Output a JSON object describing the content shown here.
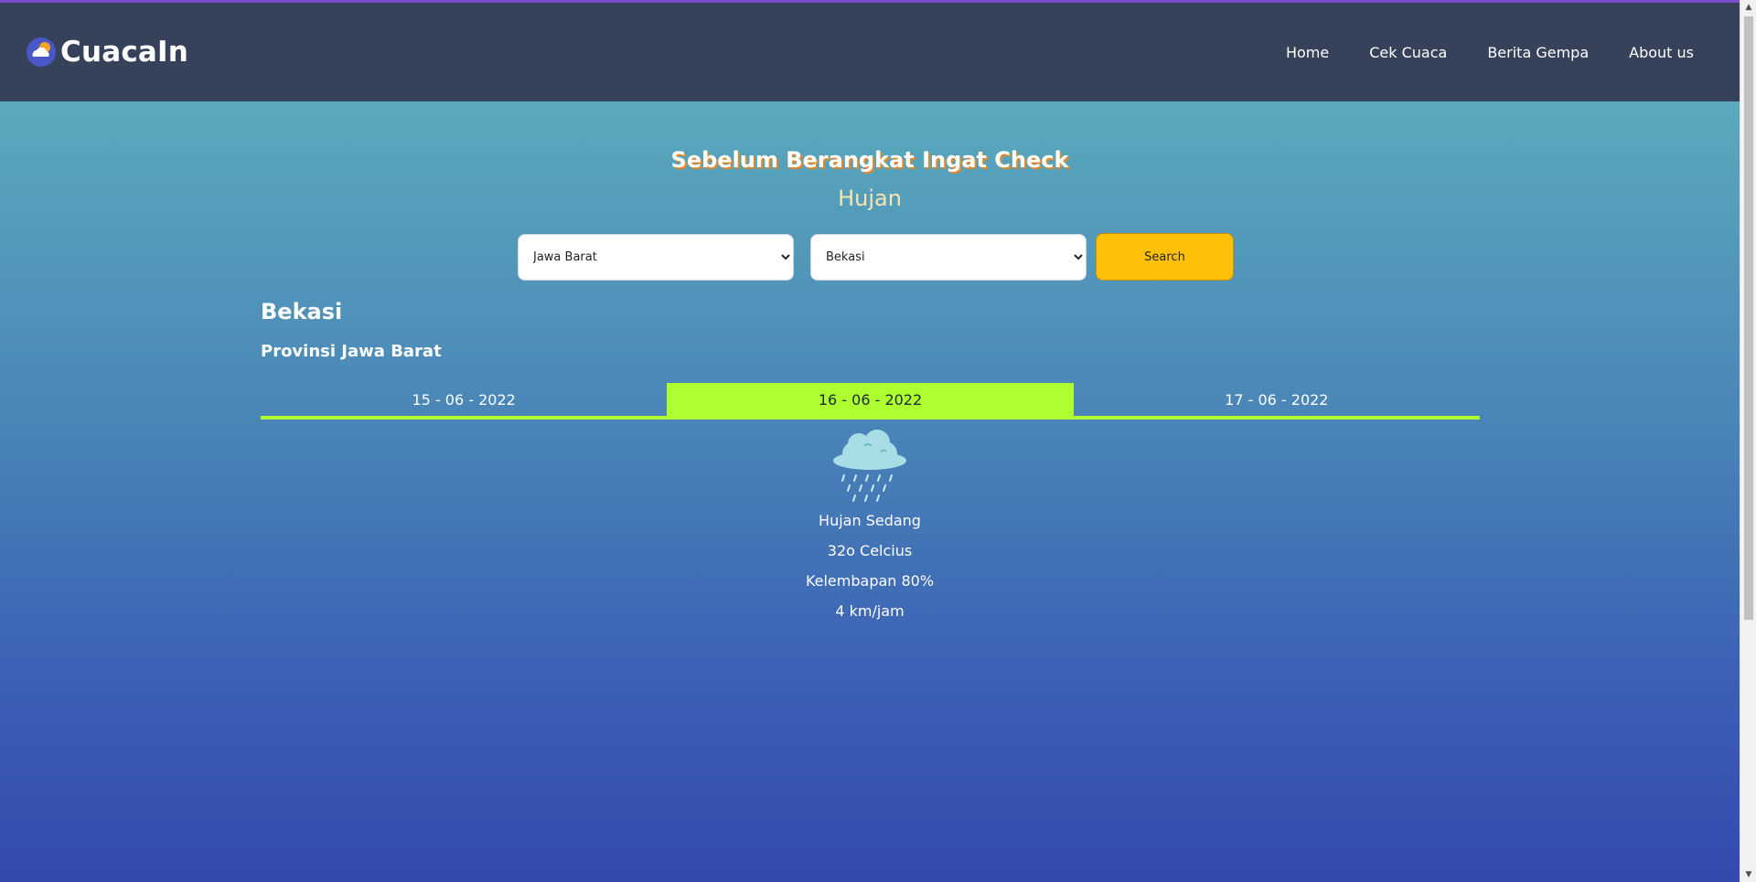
{
  "brand": {
    "name": "CuacaIn",
    "logo_icon": "cloud-sun-icon"
  },
  "nav": {
    "items": [
      {
        "label": "Home"
      },
      {
        "label": "Cek Cuaca"
      },
      {
        "label": "Berita Gempa"
      },
      {
        "label": "About us"
      }
    ]
  },
  "hero": {
    "title": "Sebelum Berangkat Ingat Check",
    "subtitle": "Hujan"
  },
  "search": {
    "province_selected": "Jawa Barat",
    "city_selected": "Bekasi",
    "button_label": "Search"
  },
  "location": {
    "city": "Bekasi",
    "province": "Provinsi Jawa Barat"
  },
  "tabs": [
    {
      "label": "15 - 06 - 2022",
      "active": false
    },
    {
      "label": "16 - 06 - 2022",
      "active": true
    },
    {
      "label": "17 - 06 - 2022",
      "active": false
    }
  ],
  "weather": {
    "icon": "rain-cloud-icon",
    "condition": "Hujan Sedang",
    "temperature": "32o Celcius",
    "humidity": "Kelembapan 80%",
    "wind": "4 km/jam"
  },
  "colors": {
    "navbar": "#36425a",
    "accent_tab": "#adff2f",
    "search_button": "#ffc107",
    "gradient_top": "#5aa9bc",
    "gradient_bottom": "#334aae"
  }
}
